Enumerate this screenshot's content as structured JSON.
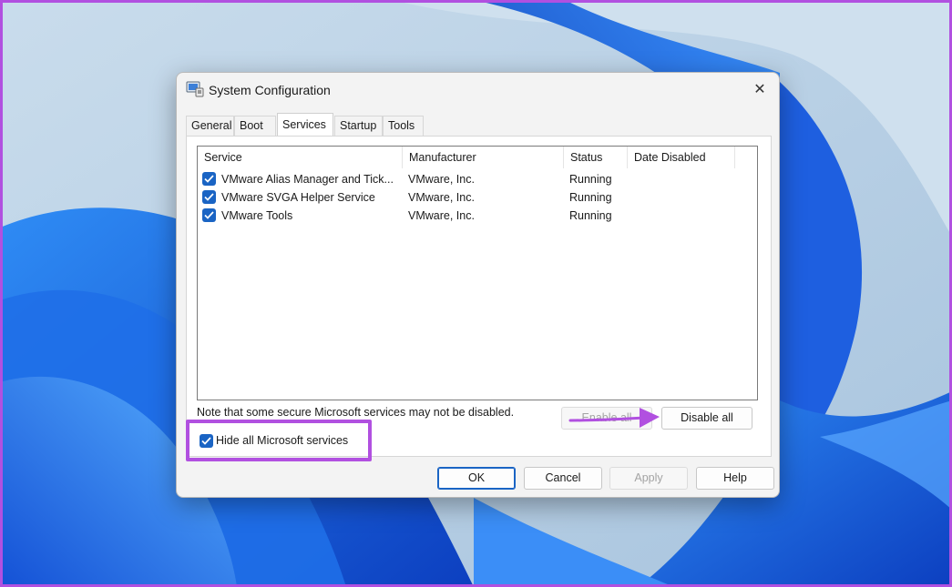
{
  "window": {
    "title": "System Configuration",
    "close_glyph": "✕",
    "icon": "msconfig-icon"
  },
  "tabs": [
    {
      "label": "General",
      "active": false
    },
    {
      "label": "Boot",
      "active": false
    },
    {
      "label": "Services",
      "active": true
    },
    {
      "label": "Startup",
      "active": false
    },
    {
      "label": "Tools",
      "active": false
    }
  ],
  "services_table": {
    "columns": [
      "Service",
      "Manufacturer",
      "Status",
      "Date Disabled"
    ],
    "rows": [
      {
        "checked": true,
        "service": "VMware Alias Manager and Tick...",
        "manufacturer": "VMware, Inc.",
        "status": "Running",
        "date_disabled": ""
      },
      {
        "checked": true,
        "service": "VMware SVGA Helper Service",
        "manufacturer": "VMware, Inc.",
        "status": "Running",
        "date_disabled": ""
      },
      {
        "checked": true,
        "service": "VMware Tools",
        "manufacturer": "VMware, Inc.",
        "status": "Running",
        "date_disabled": ""
      }
    ]
  },
  "note": "Note that some secure Microsoft services may not be disabled.",
  "enable_all_label": "Enable all",
  "disable_all_label": "Disable all",
  "hide_ms_services": {
    "label": "Hide all Microsoft services",
    "checked": true
  },
  "footer": {
    "ok_label": "OK",
    "cancel_label": "Cancel",
    "apply_label": "Apply",
    "help_label": "Help"
  },
  "colors": {
    "accent": "#1a64c4",
    "annotation": "#b150e0"
  }
}
